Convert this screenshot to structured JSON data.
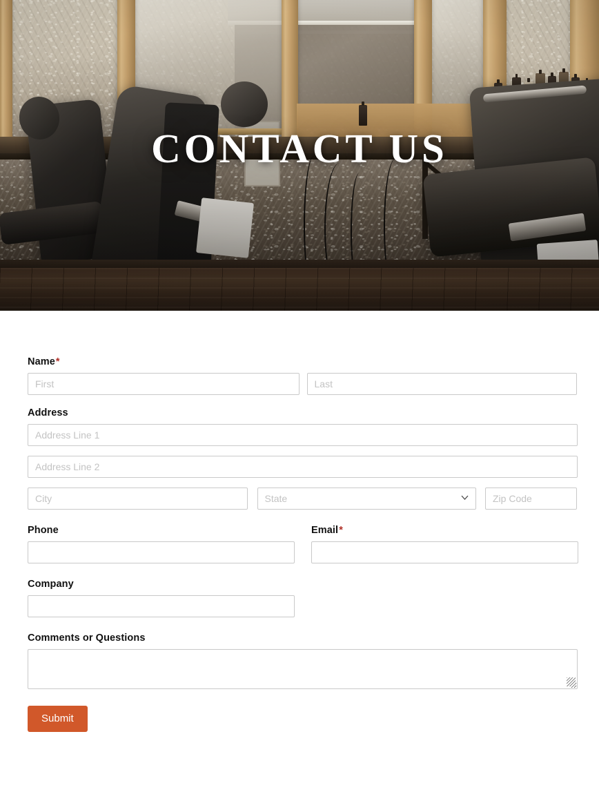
{
  "hero": {
    "title": "CONTACT US",
    "scene_alt": "barbershop-interior-photo"
  },
  "form": {
    "name": {
      "label": "Name",
      "required_mark": "*",
      "first_placeholder": "First",
      "first_value": "",
      "last_placeholder": "Last",
      "last_value": ""
    },
    "address": {
      "label": "Address",
      "line1_placeholder": "Address Line 1",
      "line1_value": "",
      "line2_placeholder": "Address Line 2",
      "line2_value": "",
      "city_placeholder": "City",
      "city_value": "",
      "state_placeholder": "State",
      "state_value": "",
      "zip_placeholder": "Zip Code",
      "zip_value": ""
    },
    "phone": {
      "label": "Phone",
      "value": "",
      "placeholder": ""
    },
    "email": {
      "label": "Email",
      "required_mark": "*",
      "value": "",
      "placeholder": ""
    },
    "company": {
      "label": "Company",
      "value": "",
      "placeholder": ""
    },
    "comments": {
      "label": "Comments or Questions",
      "value": "",
      "placeholder": ""
    },
    "submit_label": "Submit"
  },
  "colors": {
    "accent": "#d1582a",
    "required": "#b03028",
    "label": "#111111",
    "border": "#c9c9c9",
    "placeholder": "#c3c3c3"
  }
}
